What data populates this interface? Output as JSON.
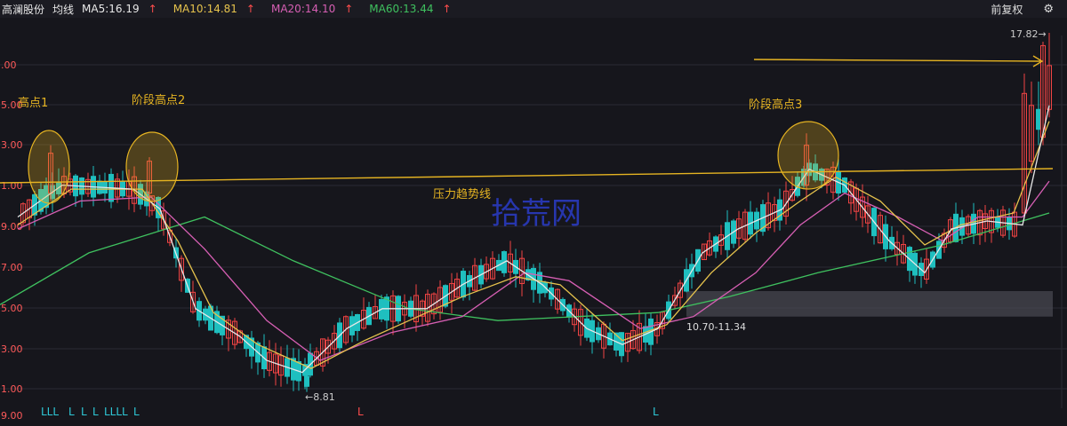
{
  "header": {
    "stock_name": "高澜股份",
    "line_mode": "均线",
    "ma5": "MA5:16.19",
    "ma10": "MA10:14.81",
    "ma20": "MA20:14.10",
    "ma60": "MA60:13.44",
    "arrow": "↑",
    "adjust": "前复权",
    "settings_icon": "gear-icon"
  },
  "colors": {
    "background": "#16161c",
    "up_candle": "#f24444",
    "down_candle": "#1fbfbf",
    "ma5": "#e8e8e8",
    "ma10": "#e6c34d",
    "ma20": "#d75fb4",
    "ma60": "#3fc15f",
    "annotation": "#e6b422"
  },
  "chart_data": {
    "type": "candlestick",
    "y_ticks": [
      ".00",
      "5.00",
      "3.00",
      "1.00",
      "9.00",
      "7.00",
      "5.00",
      "3.00",
      "1.00",
      "9.00"
    ],
    "ylim": [
      8.4,
      18.2
    ],
    "highest_label": "17.82→",
    "lowest_label": "←8.81",
    "range_label": "10.70-11.34",
    "range_zone": [
      10.7,
      11.34
    ],
    "annotations": {
      "peak1": "高点1",
      "peak2": "阶段高点2",
      "peak3": "阶段高点3",
      "trendline": "压力趋势线"
    },
    "watermark": "拾荒网",
    "bottom_markers": [
      {
        "text": "LLL",
        "color": "#2ec7d6"
      },
      {
        "text": "L",
        "color": "#2ec7d6"
      },
      {
        "text": "L",
        "color": "#2ec7d6"
      },
      {
        "text": "L",
        "color": "#2ec7d6"
      },
      {
        "text": "LLLL",
        "color": "#2ec7d6"
      },
      {
        "text": "L",
        "color": "#2ec7d6"
      },
      {
        "text": "L",
        "color": "#ff4d4d"
      },
      {
        "text": "L",
        "color": "#2ec7d6"
      }
    ],
    "ma_series": {
      "ma60": [
        [
          0,
          11.0
        ],
        [
          100,
          12.3
        ],
        [
          230,
          13.2
        ],
        [
          330,
          12.1
        ],
        [
          460,
          10.9
        ],
        [
          560,
          10.6
        ],
        [
          740,
          10.8
        ],
        [
          820,
          11.2
        ],
        [
          920,
          11.8
        ],
        [
          1060,
          12.5
        ],
        [
          1180,
          13.3
        ]
      ],
      "ma20": [
        [
          20,
          12.9
        ],
        [
          90,
          13.6
        ],
        [
          170,
          13.7
        ],
        [
          230,
          12.4
        ],
        [
          300,
          10.6
        ],
        [
          360,
          9.6
        ],
        [
          440,
          10.3
        ],
        [
          520,
          10.7
        ],
        [
          590,
          11.8
        ],
        [
          640,
          11.6
        ],
        [
          720,
          10.4
        ],
        [
          780,
          10.7
        ],
        [
          850,
          11.8
        ],
        [
          900,
          13.0
        ],
        [
          950,
          13.8
        ],
        [
          1010,
          13.2
        ],
        [
          1060,
          12.6
        ],
        [
          1100,
          13.2
        ],
        [
          1150,
          13.2
        ],
        [
          1180,
          14.1
        ]
      ],
      "ma10": [
        [
          20,
          13.0
        ],
        [
          80,
          13.9
        ],
        [
          160,
          13.9
        ],
        [
          200,
          12.6
        ],
        [
          240,
          10.8
        ],
        [
          290,
          10.0
        ],
        [
          350,
          9.4
        ],
        [
          410,
          10.1
        ],
        [
          470,
          10.7
        ],
        [
          520,
          11.2
        ],
        [
          580,
          11.7
        ],
        [
          630,
          11.5
        ],
        [
          700,
          10.1
        ],
        [
          750,
          10.5
        ],
        [
          800,
          11.8
        ],
        [
          850,
          12.8
        ],
        [
          900,
          13.6
        ],
        [
          940,
          14.2
        ],
        [
          990,
          13.6
        ],
        [
          1040,
          12.5
        ],
        [
          1080,
          13.0
        ],
        [
          1140,
          13.3
        ],
        [
          1180,
          15.6
        ]
      ],
      "ma5": [
        [
          20,
          13.2
        ],
        [
          70,
          14.0
        ],
        [
          150,
          13.9
        ],
        [
          180,
          13.4
        ],
        [
          220,
          10.9
        ],
        [
          270,
          10.2
        ],
        [
          300,
          9.6
        ],
        [
          340,
          9.3
        ],
        [
          390,
          10.4
        ],
        [
          430,
          10.9
        ],
        [
          480,
          10.9
        ],
        [
          520,
          11.5
        ],
        [
          570,
          12.1
        ],
        [
          610,
          11.5
        ],
        [
          660,
          10.4
        ],
        [
          700,
          10.0
        ],
        [
          740,
          10.4
        ],
        [
          790,
          12.3
        ],
        [
          830,
          12.9
        ],
        [
          880,
          13.4
        ],
        [
          910,
          14.4
        ],
        [
          950,
          14.0
        ],
        [
          1000,
          12.6
        ],
        [
          1040,
          11.8
        ],
        [
          1070,
          12.9
        ],
        [
          1110,
          13.1
        ],
        [
          1150,
          13.0
        ],
        [
          1180,
          16.0
        ]
      ]
    },
    "candles": []
  }
}
